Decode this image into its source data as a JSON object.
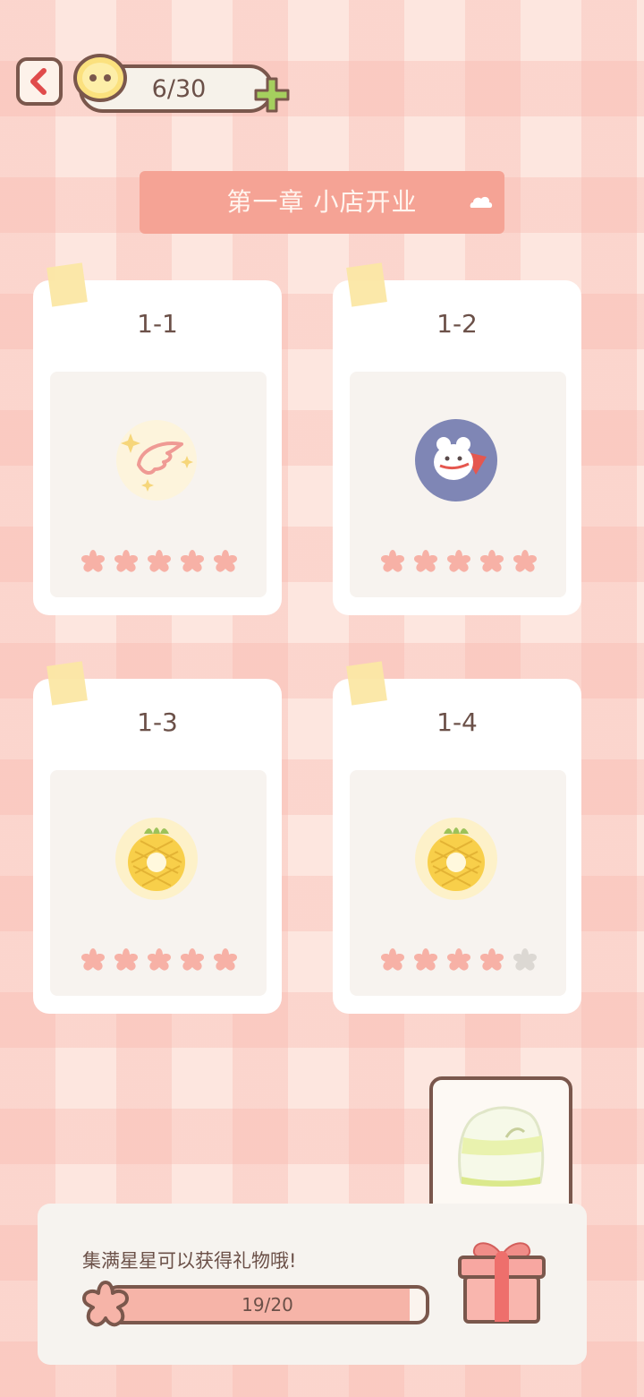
{
  "top_bar": {
    "back_icon": "chevron-left-icon",
    "energy": "6/30",
    "energy_icon": "face-coin-icon",
    "add_icon": "plus-icon"
  },
  "chapter": {
    "title": "第一章  小店开业",
    "toggle_icon": "cloud-up-icon"
  },
  "levels": [
    {
      "label": "1-1",
      "reward_icon": "wing-icon",
      "stars_earned": 5,
      "stars_total": 5
    },
    {
      "label": "1-2",
      "reward_icon": "hamster-badge-icon",
      "stars_earned": 5,
      "stars_total": 5
    },
    {
      "label": "1-3",
      "reward_icon": "pineapple-icon",
      "stars_earned": 5,
      "stars_total": 5
    },
    {
      "label": "1-4",
      "reward_icon": "pineapple-icon",
      "stars_earned": 4,
      "stars_total": 5
    }
  ],
  "progress": {
    "hint": "集满星星可以获得礼物哦!",
    "text": "19/20",
    "current": 19,
    "total": 20,
    "reward_preview_icon": "lettuce-icon",
    "gift_icon": "gift-box-icon"
  },
  "colors": {
    "star_filled": "#f7b1a6",
    "star_empty": "#dcd8d3",
    "accent": "#f5a395",
    "outline": "#7a574c"
  }
}
